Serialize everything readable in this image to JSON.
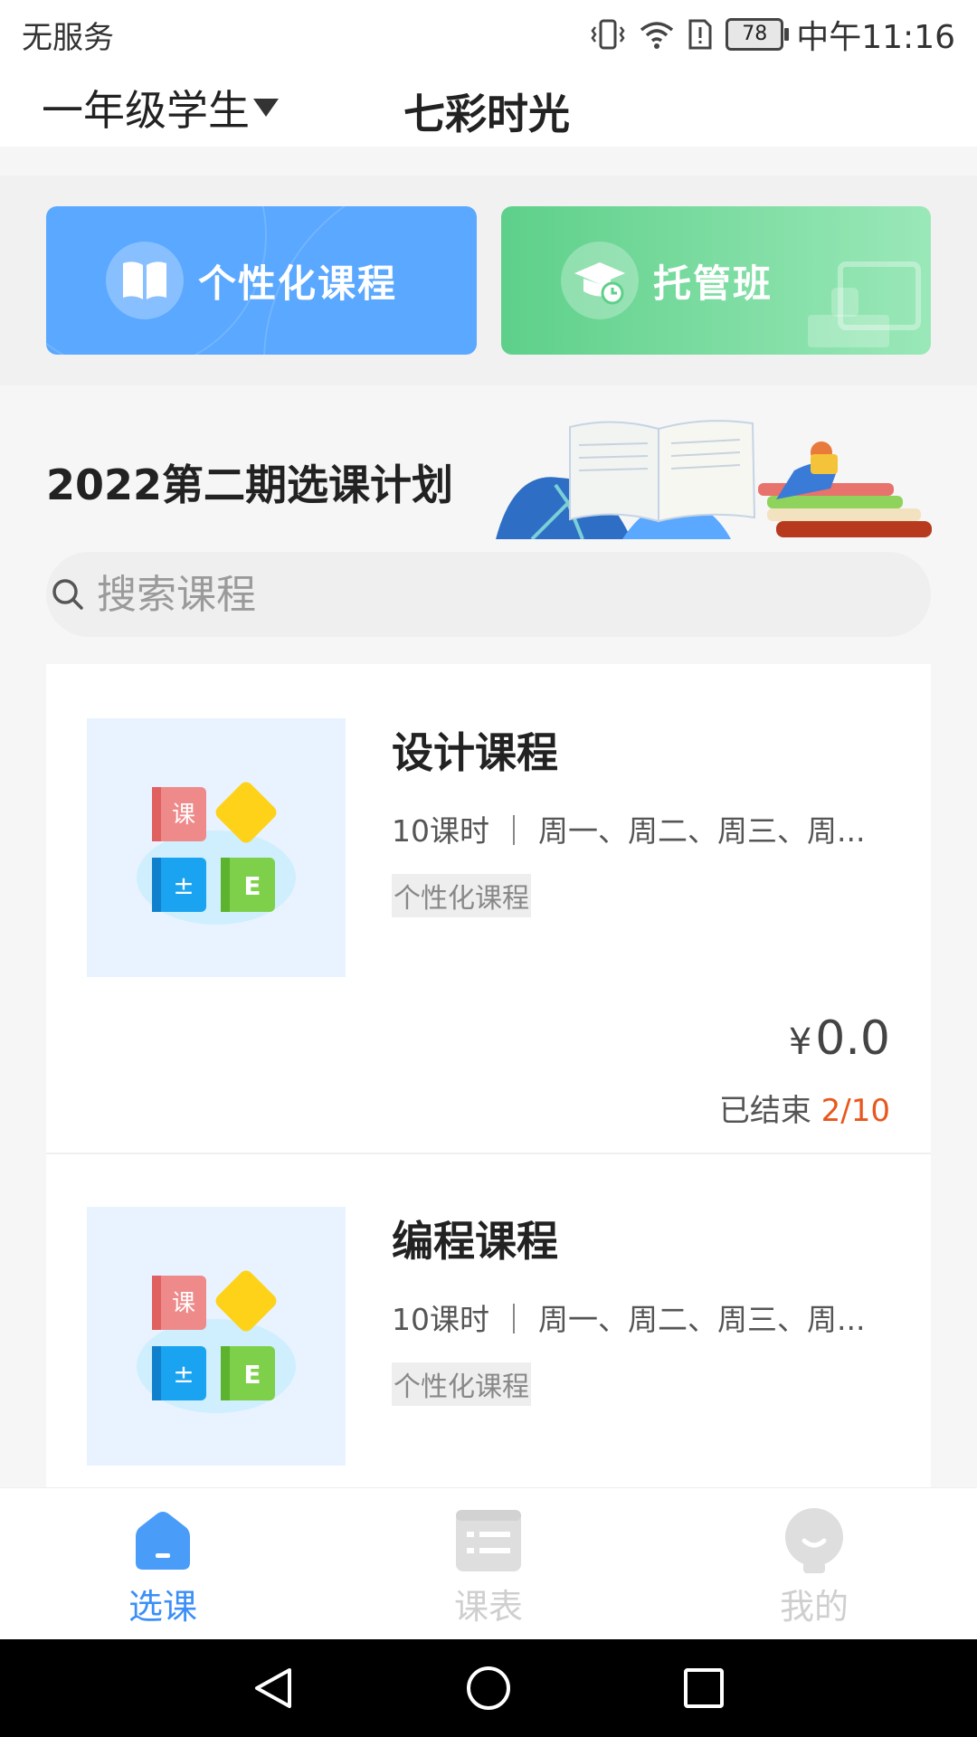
{
  "status_bar": {
    "carrier": "无服务",
    "battery": "78",
    "time": "中午11:16"
  },
  "header": {
    "grade_selector": "一年级学生",
    "title": "七彩时光"
  },
  "features": [
    {
      "label": "个性化课程",
      "icon": "book-icon",
      "color": "#5aa8ff"
    },
    {
      "label": "托管班",
      "icon": "graduation-cap-icon",
      "color": "#5ed08a"
    }
  ],
  "plan": {
    "title": "2022第二期选课计划"
  },
  "search": {
    "placeholder": "搜索课程"
  },
  "courses": [
    {
      "title": "设计课程",
      "meta": "10课时 ｜ 周一、周二、周三、周...",
      "tag": "个性化课程",
      "price_symbol": "¥",
      "price": "0.0",
      "status": "已结束",
      "enrolled": "2/10"
    },
    {
      "title": "编程课程",
      "meta": "10课时 ｜ 周一、周二、周三、周...",
      "tag": "个性化课程"
    }
  ],
  "thumb_labels": {
    "ke": "课",
    "pm": "±",
    "e": "E"
  },
  "tabs": [
    {
      "label": "选课",
      "icon": "home-icon",
      "active": true,
      "color": "#3b8ff7"
    },
    {
      "label": "课表",
      "icon": "list-icon",
      "active": false
    },
    {
      "label": "我的",
      "icon": "profile-icon",
      "active": false
    }
  ]
}
